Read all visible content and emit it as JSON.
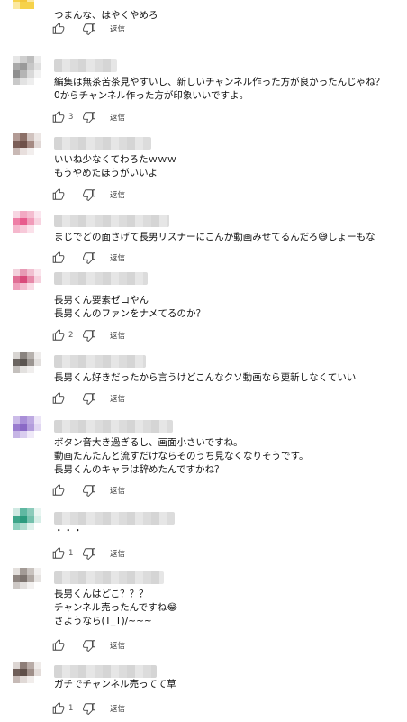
{
  "reply_label": "返信",
  "icons": {
    "like": "thumb-up-icon",
    "dislike": "thumb-down-icon"
  },
  "comments": [
    {
      "lines": [
        "つまんな、はやくやめろ"
      ],
      "likes": "",
      "avatar": [
        "#f6d24a",
        "#f6d24a",
        "#fbe8a0",
        "#ffffff",
        "#f6d24a",
        "#f3c63a",
        "#fbe8a0",
        "#ffffff",
        "#fbe8a0",
        "#f6d24a",
        "#f6d24a",
        "#ffffff",
        "#ffffff",
        "#ffffff",
        "#ffffff",
        "#ffffff"
      ]
    },
    {
      "lines": [
        "編集は無茶苦茶見やすいし、新しいチャンネル作った方が良かったんじゃね？",
        "0からチャンネル作った方が印象いいですよ。"
      ],
      "likes": "3",
      "avatar": [
        "#e6e6e6",
        "#cfcfcf",
        "#bdbdbd",
        "#ececec",
        "#a9a9a9",
        "#9a9a9a",
        "#c7c7c7",
        "#e0e0e0",
        "#8f8f8f",
        "#b5b5b5",
        "#d9d9d9",
        "#f2f2f2",
        "#c9c9c9",
        "#e3e3e3",
        "#eeeeee",
        "#ffffff"
      ]
    },
    {
      "lines": [
        "いいね少なくてわろたｗｗｗ",
        "もうやめたほうがいいよ"
      ],
      "likes": "",
      "avatar": [
        "#b39b95",
        "#8c7068",
        "#d1c3bf",
        "#ece6e4",
        "#7b5e57",
        "#6e5049",
        "#a58a83",
        "#e1d8d6",
        "#c9b9b5",
        "#e8dfdd",
        "#f2eeed",
        "#ffffff",
        "#ffffff",
        "#ffffff",
        "#ffffff",
        "#ffffff"
      ]
    },
    {
      "lines": [
        "まじでどの面さげて長男リスナーにこんか動画みせてるんだろ😅しょーもな"
      ],
      "likes": "",
      "avatar": [
        "#f7d6e2",
        "#f2a9c3",
        "#f4bdd0",
        "#fbe5ee",
        "#ee7fa6",
        "#e85b8d",
        "#f19bb9",
        "#f8d3e0",
        "#f5b8cd",
        "#f7c9d9",
        "#fbe1ea",
        "#ffffff",
        "#ffffff",
        "#ffffff",
        "#ffffff",
        "#ffffff"
      ]
    },
    {
      "lines": [
        "長男くん要素ゼロやん",
        "長男くんのファンをナメてるのか？"
      ],
      "likes": "2",
      "avatar": [
        "#f3d0dc",
        "#e79ab5",
        "#f1c0d1",
        "#fae4ec",
        "#e06e95",
        "#d94a7b",
        "#e78aaa",
        "#f6d0dd",
        "#ee9fbb",
        "#f3bccf",
        "#f9dbe5",
        "#ffffff",
        "#ffffff",
        "#ffffff",
        "#ffffff",
        "#ffffff"
      ]
    },
    {
      "lines": [
        "長男くん好きだったから言うけどこんなクソ動画なら更新しなくていい"
      ],
      "likes": "",
      "avatar": [
        "#d8d5d2",
        "#8a8480",
        "#b7b2ae",
        "#eeeceb",
        "#6b6561",
        "#5a5450",
        "#9b9591",
        "#e2dfdd",
        "#c4c0bd",
        "#e3e1df",
        "#f0eeed",
        "#ffffff",
        "#ffffff",
        "#ffffff",
        "#ffffff",
        "#ffffff"
      ]
    },
    {
      "lines": [
        "ボタン音大き過ぎるし、画面小さいですね。",
        "動画たんたんと流すだけならそのうち見なくなりそうです。",
        "長男くんのキャラは辞めたんですかね？"
      ],
      "likes": "",
      "avatar": [
        "#cbbbe8",
        "#a98fd8",
        "#bda9e1",
        "#ece5f7",
        "#9a7ccf",
        "#8a69c6",
        "#b39ddc",
        "#e1d7f2",
        "#c6b5e5",
        "#d9cdef",
        "#efe9f8",
        "#ffffff",
        "#ffffff",
        "#ffffff",
        "#ffffff",
        "#ffffff"
      ]
    },
    {
      "lines": [
        "・・・"
      ],
      "likes": "1",
      "avatar": [
        "#cfe9e2",
        "#5fb8a2",
        "#8ccbbb",
        "#e8f5f1",
        "#3ea58a",
        "#2b9b7e",
        "#74c1ad",
        "#d6eee7",
        "#8fd0bf",
        "#b0dccf",
        "#dff1ec",
        "#ffffff",
        "#ffffff",
        "#ffffff",
        "#ffffff",
        "#ffffff"
      ]
    },
    {
      "lines": [
        "長男くんはどこ？？？",
        "チャンネル売ったんですね😂",
        "さようなら(T_T)/~~~"
      ],
      "likes": "",
      "avatar": [
        "#e3dfdc",
        "#a39b96",
        "#c9c3bf",
        "#f1efee",
        "#8d847f",
        "#7d746f",
        "#b0a8a3",
        "#e6e3e1",
        "#cdc8c5",
        "#e2dfdd",
        "#f3f1f0",
        "#ffffff",
        "#ffffff",
        "#ffffff",
        "#ffffff",
        "#ffffff"
      ]
    },
    {
      "lines": [
        "ガチでチャンネル売ってて草"
      ],
      "likes": "1",
      "avatar": [
        "#ddd6d3",
        "#8e7e78",
        "#b9aca7",
        "#efebe9",
        "#6f5f59",
        "#5f4f49",
        "#9f8f89",
        "#e3dcd9",
        "#c6bab6",
        "#e0d9d6",
        "#f1edeb",
        "#ffffff",
        "#ffffff",
        "#ffffff",
        "#ffffff",
        "#ffffff"
      ]
    }
  ]
}
